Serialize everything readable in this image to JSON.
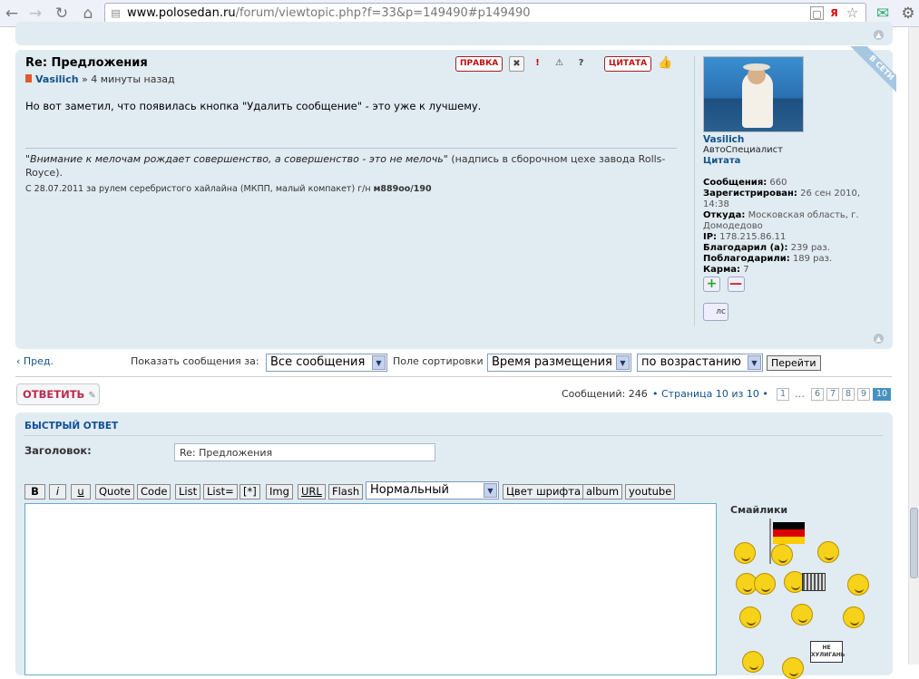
{
  "browser": {
    "url_host": "www.polosedan.ru",
    "url_path": "/forum/viewtopic.php?f=33&p=149490#p149490"
  },
  "post": {
    "title": "Re: Предложения",
    "author": "Vasilich",
    "time": "» 4 минуты назад",
    "text": "Но вот заметил, что появилась кнопка \"Удалить сообщение\" - это уже к лучшему.",
    "buttons": {
      "edit": "ПРАВКА",
      "quote": "ЦИТАТА"
    },
    "signature_quote": "\"Внимание к мелочам рождает совершенство, а совершенство - это не мелочь\"",
    "signature_note": "(надпись в сборочном цехе завода Rolls-Royce).",
    "signature_small": "С 28.07.2011 за рулем серебристого хайлайна (МКПП, малый компакет) г/н",
    "signature_plate": "м889оо/190"
  },
  "profile": {
    "online_badge": "В СЕТИ",
    "name": "Vasilich",
    "rank": "АвтоСпециалист",
    "quote_link": "Цитата",
    "fields": [
      {
        "label": "Сообщения:",
        "value": "660"
      },
      {
        "label": "Зарегистрирован:",
        "value": "26 сен 2010, 14:38"
      },
      {
        "label": "Откуда:",
        "value": "Московская область, г. Домодедово"
      },
      {
        "label": "IP:",
        "value": "178.215.86.11"
      },
      {
        "label": "Благодарил (а):",
        "value": "239 раз."
      },
      {
        "label": "Поблагодарили:",
        "value": "189 раз."
      },
      {
        "label": "Карма:",
        "value": "7"
      }
    ],
    "karma_plus": "+",
    "karma_minus": "—",
    "pm_label": "лс"
  },
  "topic_controls": {
    "prev": "Пред.",
    "show_label": "Показать сообщения за:",
    "show_value": "Все сообщения",
    "sort_label": "Поле сортировки",
    "sort_value": "Время размещения",
    "order_value": "по возрастанию",
    "go": "Перейти"
  },
  "reply_button": "ОТВЕТИТЬ",
  "pagination": {
    "count": "Сообщений: 246",
    "page": "Страница 10 из 10",
    "pages": [
      "1",
      "…",
      "6",
      "7",
      "8",
      "9",
      "10"
    ]
  },
  "quick_reply": {
    "title": "БЫСТРЫЙ ОТВЕТ",
    "subject_label": "Заголовок:",
    "subject_value": "Re: Предложения",
    "toolbar": [
      "B",
      "i",
      "u",
      "Quote",
      "Code",
      "List",
      "List=",
      "[*]",
      "Img",
      "URL",
      "Flash"
    ],
    "font_size": "Нормальный",
    "toolbar2": [
      "Цвет шрифта",
      "album",
      "youtube"
    ],
    "smilies_title": "Смайлики",
    "sign_text": "НЕ ХУЛИГАНЬ"
  }
}
